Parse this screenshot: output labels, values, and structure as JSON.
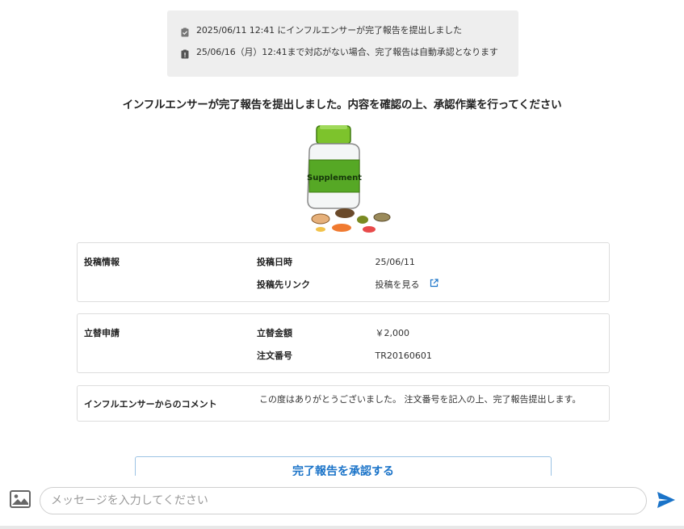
{
  "notice": {
    "submitted_text": "2025/06/11 12:41 にインフルエンサーが完了報告を提出しました",
    "deadline_text": "25/06/16（月）12:41まで対応がない場合、完了報告は自動承認となります"
  },
  "headline": "インフルエンサーが完了報告を提出しました。内容を確認の上、承認作業を行ってください",
  "illustration": {
    "label": "Supplement"
  },
  "post_info": {
    "title": "投稿情報",
    "date_label": "投稿日時",
    "date_value": "25/06/11",
    "link_label": "投稿先リンク",
    "link_text": "投稿を見る"
  },
  "reimbursement": {
    "title": "立替申請",
    "amount_label": "立替金額",
    "amount_value": "￥2,000",
    "order_label": "注文番号",
    "order_value": "TR20160601"
  },
  "comment": {
    "title": "インフルエンサーからのコメント",
    "text": "この度はありがとうございました。 注文番号を記入の上、完了報告提出します。"
  },
  "approve_button": "完了報告を承認する",
  "composer": {
    "placeholder": "メッセージを入力してください"
  },
  "colors": {
    "accent": "#1a73c8",
    "notice_bg": "#eeeeee",
    "border": "#dddddd"
  }
}
